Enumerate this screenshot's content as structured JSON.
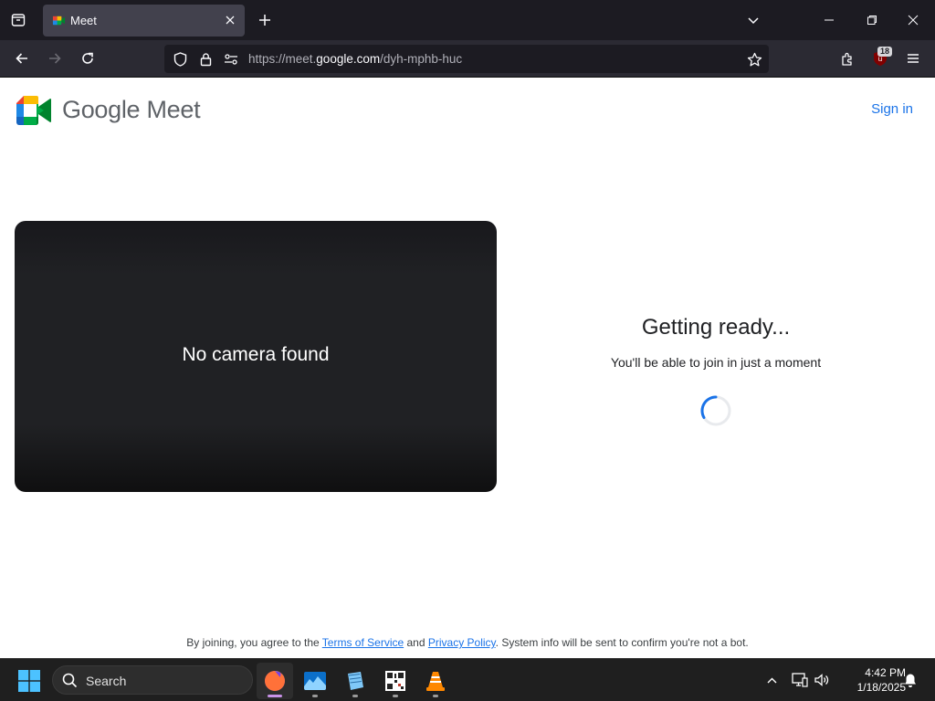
{
  "browser": {
    "tab": {
      "title": "Meet",
      "favicon": "google-meet-icon"
    },
    "url": {
      "prefix": "https://meet.",
      "domain": "google.com",
      "path": "/dyh-mphb-huc"
    },
    "extension_badge": "18"
  },
  "page": {
    "brand": "Google Meet",
    "sign_in": "Sign in",
    "preview": {
      "status": "No camera found"
    },
    "status": {
      "title": "Getting ready...",
      "subtitle": "You'll be able to join in just a moment"
    },
    "footer": {
      "prefix": "By joining, you agree to the ",
      "terms": "Terms of Service",
      "and": " and ",
      "privacy": "Privacy Policy",
      "suffix": ". System info will be sent to confirm you're not a bot."
    }
  },
  "taskbar": {
    "search_placeholder": "Search",
    "apps": [
      "firefox-icon",
      "photos-icon",
      "notepad-icon",
      "qr-app-icon",
      "vlc-icon"
    ],
    "time": "4:42 PM",
    "date": "1/18/2025"
  },
  "colors": {
    "accent": "#1a73e8",
    "chrome_dark": "#1c1b22",
    "toolbar": "#2b2a33",
    "preview_bg": "#202124"
  }
}
